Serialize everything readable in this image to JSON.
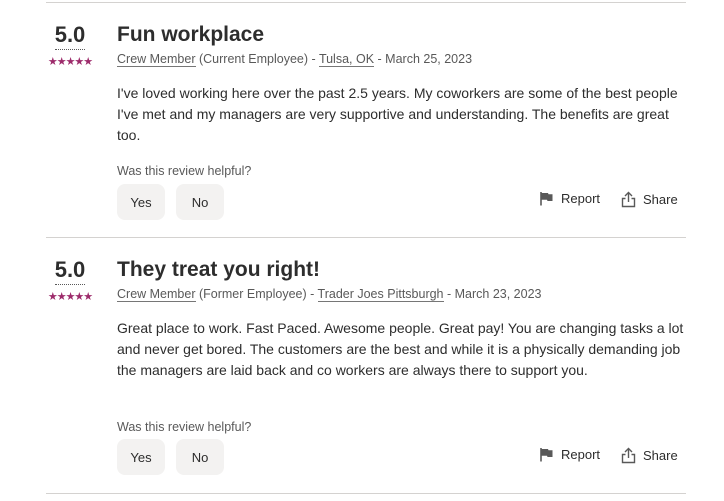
{
  "reviews": [
    {
      "rating": "5.0",
      "stars": "★★★★★",
      "title": "Fun workplace",
      "job_title": "Crew Member",
      "status": "(Current Employee) -",
      "location": "Tulsa, OK",
      "date": "- March 25, 2023",
      "text": "I've loved working here over the past 2.5 years. My coworkers are some of the best people I've met and my managers are very supportive and understanding. The benefits are great too.",
      "helpful_prompt": "Was this review helpful?",
      "yes_label": "Yes",
      "no_label": "No",
      "report_label": "Report",
      "share_label": "Share"
    },
    {
      "rating": "5.0",
      "stars": "★★★★★",
      "title": "They treat you right!",
      "job_title": "Crew Member",
      "status": "(Former Employee) -",
      "location": "Trader Joes Pittsburgh",
      "date": "- March 23, 2023",
      "text": "Great place to work. Fast Paced. Awesome people. Great pay! You are changing tasks a lot and never get bored. The customers are the best and while it is a physically demanding job the managers are laid back and co workers are always there to support you.",
      "helpful_prompt": "Was this review helpful?",
      "yes_label": "Yes",
      "no_label": "No",
      "report_label": "Report",
      "share_label": "Share"
    }
  ],
  "colors": {
    "star": "#9d2b6b",
    "divider": "#d4d2d0",
    "button_bg": "#f3f2f1"
  },
  "icons": {
    "report": "flag-icon",
    "share": "share-icon"
  }
}
